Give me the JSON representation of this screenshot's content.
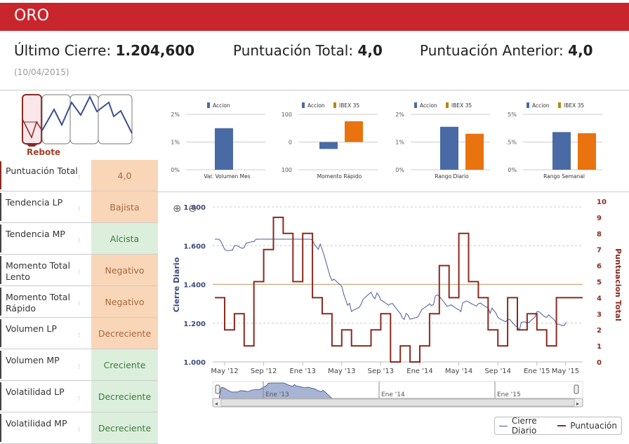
{
  "header": {
    "title": "ORO"
  },
  "stats": {
    "last_close_label": "Último Cierre:",
    "last_close_value": "1.204,600",
    "total_score_label": "Puntuación Total:",
    "total_score_value": "4,0",
    "prev_score_label": "Puntuación Anterior:",
    "prev_score_value": "4,0",
    "date": "(10/04/2015)"
  },
  "pattern": {
    "label": "Rebote"
  },
  "table": [
    {
      "label": "Puntuación Total",
      "value": "4,0",
      "color": "orange"
    },
    {
      "label": "Tendencia LP",
      "value": "Bajista",
      "color": "orange"
    },
    {
      "label": "Tendencia MP",
      "value": "Alcista",
      "color": "green"
    },
    {
      "label": "Momento Total Lento",
      "value": "Negativo",
      "color": "orange"
    },
    {
      "label": "Momento Total Rápido",
      "value": "Negativo",
      "color": "orange"
    },
    {
      "label": "Volumen LP",
      "value": "Decreciente",
      "color": "orange"
    },
    {
      "label": "Volumen MP",
      "value": "Creciente",
      "color": "green"
    },
    {
      "label": "Volatilidad LP",
      "value": "Decreciente",
      "color": "green"
    },
    {
      "label": "Volatilidad MP",
      "value": "Decreciente",
      "color": "green"
    }
  ],
  "colors": {
    "accion": "#4a6aa5",
    "ibex": "#e8730f",
    "ibex_legend": "#b8860b",
    "score": "#8b2a20",
    "close": "#4a5a9a",
    "header": "#c9252c"
  },
  "chart_data": [
    {
      "type": "bar",
      "xlabel": "Var. Volumen Mes",
      "yticks": [
        "0%",
        "1%",
        "2%"
      ],
      "ylim": [
        0,
        2
      ],
      "series": [
        {
          "name": "Accion",
          "values": [
            1.5
          ]
        }
      ]
    },
    {
      "type": "bar",
      "xlabel": "Momento Rápido",
      "yticks": [
        "-100",
        "0",
        "100"
      ],
      "ylim": [
        -100,
        100
      ],
      "series": [
        {
          "name": "Accion",
          "values": [
            -25
          ]
        },
        {
          "name": "IBEX 35",
          "values": [
            75
          ]
        }
      ]
    },
    {
      "type": "bar",
      "xlabel": "Rango Diario",
      "yticks": [
        "0%",
        "1%",
        "2%"
      ],
      "ylim": [
        0,
        2
      ],
      "series": [
        {
          "name": "Accion",
          "values": [
            1.55
          ]
        },
        {
          "name": "IBEX 35",
          "values": [
            1.3
          ]
        }
      ]
    },
    {
      "type": "bar",
      "xlabel": "Rango Semanal",
      "yticks": [
        "0%",
        "2.5%",
        "5%"
      ],
      "ylim": [
        0,
        5
      ],
      "series": [
        {
          "name": "Accion",
          "values": [
            3.4
          ]
        },
        {
          "name": "IBEX 35",
          "values": [
            3.3
          ]
        }
      ]
    },
    {
      "type": "line",
      "ylabel": "Cierre Diario",
      "y2label": "Puntuacion Total",
      "ylim": [
        1000,
        1800
      ],
      "y2lim": [
        0,
        10
      ],
      "reference_line": 1400,
      "yticks": [
        "1.000",
        "1.200",
        "1.400",
        "1.600",
        "1.800"
      ],
      "y2ticks": [
        "0",
        "1",
        "2",
        "3",
        "4",
        "5",
        "6",
        "7",
        "8",
        "9",
        "10"
      ],
      "xticks": [
        "May '12",
        "Sep '12",
        "Ene '13",
        "May '13",
        "Sep '13",
        "Ene '14",
        "May '14",
        "Sep '14",
        "Ene '15",
        "May '15"
      ],
      "navigator_ticks": [
        "Ene '13",
        "Ene '14",
        "Ene '15"
      ],
      "series": [
        {
          "name": "Cierre Diario",
          "x": [
            "2012-04",
            "2012-05",
            "2012-06",
            "2012-07",
            "2012-08",
            "2012-09",
            "2012-10",
            "2012-11",
            "2012-12",
            "2013-01",
            "2013-02",
            "2013-03",
            "2013-04",
            "2013-05",
            "2013-06",
            "2013-07",
            "2013-08",
            "2013-09",
            "2013-10",
            "2013-11",
            "2013-12",
            "2014-01",
            "2014-02",
            "2014-03",
            "2014-04",
            "2014-05",
            "2014-06",
            "2014-07",
            "2014-08",
            "2014-09",
            "2014-10",
            "2014-11",
            "2014-12",
            "2015-01",
            "2015-02",
            "2015-03",
            "2015-04"
          ],
          "values": [
            1660,
            1580,
            1600,
            1590,
            1620,
            1740,
            1770,
            1720,
            1690,
            1660,
            1630,
            1580,
            1420,
            1390,
            1260,
            1300,
            1360,
            1320,
            1300,
            1250,
            1220,
            1250,
            1300,
            1340,
            1290,
            1270,
            1310,
            1300,
            1280,
            1230,
            1220,
            1180,
            1200,
            1260,
            1230,
            1200,
            1205
          ]
        },
        {
          "name": "Puntuación",
          "x": [
            "2012-04",
            "2012-05",
            "2012-06",
            "2012-07",
            "2012-08",
            "2012-09",
            "2012-10",
            "2012-11",
            "2012-12",
            "2013-01",
            "2013-02",
            "2013-03",
            "2013-04",
            "2013-05",
            "2013-06",
            "2013-07",
            "2013-08",
            "2013-09",
            "2013-10",
            "2013-11",
            "2013-12",
            "2014-01",
            "2014-02",
            "2014-03",
            "2014-04",
            "2014-05",
            "2014-06",
            "2014-07",
            "2014-08",
            "2014-09",
            "2014-10",
            "2014-11",
            "2014-12",
            "2015-01",
            "2015-02",
            "2015-03",
            "2015-04"
          ],
          "values": [
            4,
            2,
            3,
            1,
            5,
            7,
            9,
            8,
            5,
            8,
            4,
            3,
            1,
            2,
            1,
            1,
            2,
            3,
            0,
            1,
            0,
            1,
            3,
            6,
            4,
            8,
            5,
            4,
            2,
            1,
            4,
            2,
            3,
            2,
            1,
            4,
            4
          ]
        }
      ]
    }
  ],
  "legend": {
    "close": "Cierre Diario",
    "score": "Puntuación"
  }
}
